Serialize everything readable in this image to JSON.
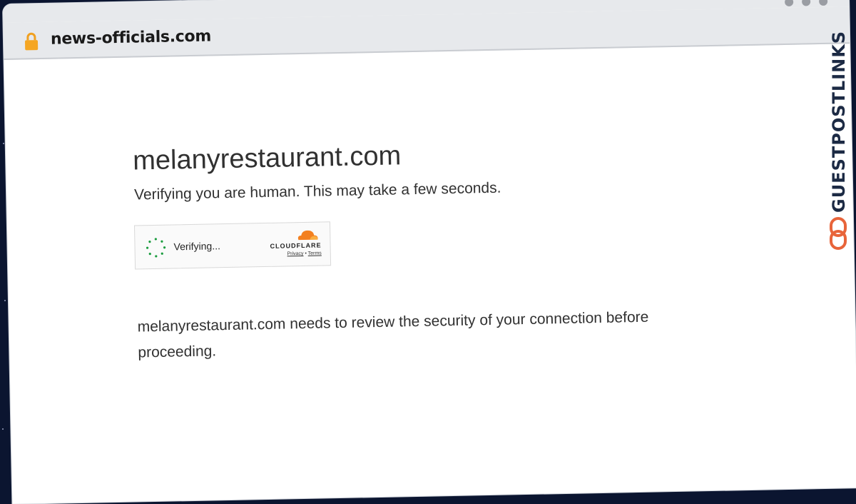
{
  "browser": {
    "url": "news-officials.com",
    "lock_icon": "lock-icon",
    "window_controls": [
      "dot",
      "dot",
      "dot"
    ]
  },
  "page": {
    "site_title": "melanyrestaurant.com",
    "subtitle": "Verifying you are human. This may take a few seconds.",
    "notice": "melanyrestaurant.com needs to review the security of your connection before proceeding."
  },
  "widget": {
    "status_label": "Verifying...",
    "brand": "CLOUDFLARE",
    "privacy_link": "Privacy",
    "separator": "•",
    "terms_link": "Terms"
  },
  "branding": {
    "text": "GUESTPOSTLINKS",
    "accent_color": "#e8643a",
    "text_color": "#1c2a44"
  }
}
